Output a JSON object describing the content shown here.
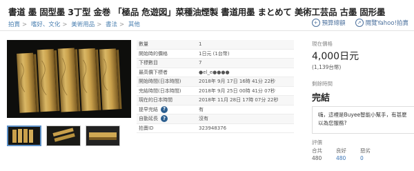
{
  "listing": {
    "title": "書道 墨 固型墨 3丁型 金巻 「極品 危遊図」菜種油煙製 書道用墨 まとめて 美術工芸品 古墨 固形墨"
  },
  "breadcrumb": [
    "拍賣",
    "嗜好、文化",
    "美術用品",
    "書法",
    "其他"
  ],
  "actions": {
    "add_favorite": "預算總額",
    "translate": "閱覽Yahoo!拍賣"
  },
  "details": [
    {
      "label": "數量",
      "value": "1"
    },
    {
      "label": "開始時的價格",
      "value": "1日元 (1台幣)"
    },
    {
      "label": "下標數目",
      "value": "7"
    },
    {
      "label": "最高價下標者",
      "value": "●el_e●●●●"
    },
    {
      "label": "開始時間(日本時間)",
      "value": "2018年 9月 17日 16時 41分 22秒"
    },
    {
      "label": "完結時間(日本時間)",
      "value": "2018年 9月 25日 00時 41分 07秒"
    },
    {
      "label": "現在的日本時間",
      "value": "2018年 11月 28日 17時 07分 22秒"
    },
    {
      "label": "提早完結",
      "value": "有"
    },
    {
      "label": "自動延長",
      "value": "沒有"
    },
    {
      "label": "拍賣ID",
      "value": "323948376"
    }
  ],
  "price": {
    "label": "現在價格",
    "jpy": "4,000日元",
    "twd": "(1,139台幣)"
  },
  "remaining": {
    "label": "剩餘時間",
    "value": "完結"
  },
  "chat": {
    "line1": "嗨，這裡是Buyee智能小幫手，有甚麼",
    "line2": "以為您服務?"
  },
  "rating": {
    "label": "評價",
    "cols": [
      {
        "label": "合共",
        "value": "480"
      },
      {
        "label": "良好",
        "value": "480"
      },
      {
        "label": "惡劣",
        "value": "0"
      }
    ]
  },
  "colors": {
    "link": "#4a7fb0",
    "accent": "#2b5e8f",
    "gold": "#b8923e"
  }
}
